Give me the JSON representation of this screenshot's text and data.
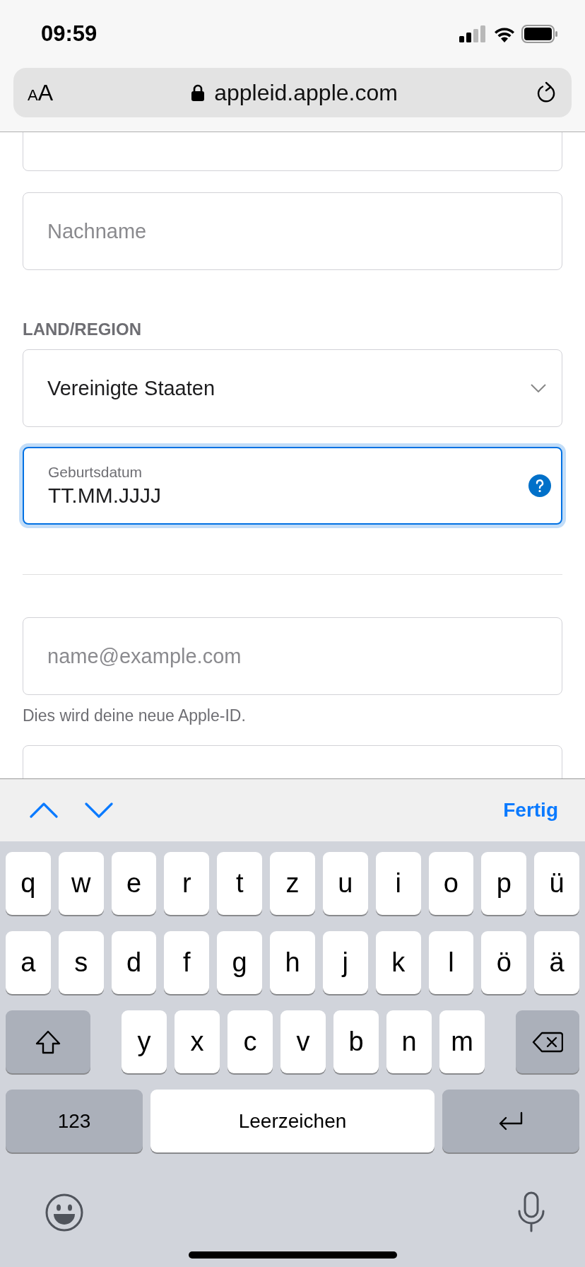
{
  "status_bar": {
    "time": "09:59"
  },
  "address_bar": {
    "text_size_label": "AA",
    "url": "appleid.apple.com"
  },
  "form": {
    "items": [
      {
        "kind": "text"
      },
      {
        "kind": "text",
        "placeholder": "Nachname"
      },
      {
        "kind": "section",
        "label": "LAND/REGION"
      },
      {
        "kind": "select",
        "value": "Vereinigte Staaten"
      },
      {
        "kind": "date",
        "label": "Geburtsdatum",
        "value": "TT.MM.JJJJ",
        "focused": true
      },
      {
        "kind": "divider"
      },
      {
        "kind": "text",
        "placeholder": "name@example.com"
      },
      {
        "kind": "hint",
        "text": "Dies wird deine neue Apple-ID."
      },
      {
        "kind": "password"
      }
    ]
  },
  "keyboard_toolbar": {
    "done": "Fertig"
  },
  "keyboard": {
    "rows": [
      {
        "keys": [
          {
            "kind": "letter",
            "label": "q"
          },
          {
            "kind": "letter",
            "label": "w"
          },
          {
            "kind": "letter",
            "label": "e"
          },
          {
            "kind": "letter",
            "label": "r"
          },
          {
            "kind": "letter",
            "label": "t"
          },
          {
            "kind": "letter",
            "label": "z"
          },
          {
            "kind": "letter",
            "label": "u"
          },
          {
            "kind": "letter",
            "label": "i"
          },
          {
            "kind": "letter",
            "label": "o"
          },
          {
            "kind": "letter",
            "label": "p"
          },
          {
            "kind": "letter",
            "label": "ü"
          }
        ]
      },
      {
        "keys": [
          {
            "kind": "letter",
            "label": "a"
          },
          {
            "kind": "letter",
            "label": "s"
          },
          {
            "kind": "letter",
            "label": "d"
          },
          {
            "kind": "letter",
            "label": "f"
          },
          {
            "kind": "letter",
            "label": "g"
          },
          {
            "kind": "letter",
            "label": "h"
          },
          {
            "kind": "letter",
            "label": "j"
          },
          {
            "kind": "letter",
            "label": "k"
          },
          {
            "kind": "letter",
            "label": "l"
          },
          {
            "kind": "letter",
            "label": "ö"
          },
          {
            "kind": "letter",
            "label": "ä"
          }
        ]
      },
      {
        "keys": [
          {
            "kind": "shift"
          },
          {
            "kind": "letter",
            "label": "y"
          },
          {
            "kind": "letter",
            "label": "x"
          },
          {
            "kind": "letter",
            "label": "c"
          },
          {
            "kind": "letter",
            "label": "v"
          },
          {
            "kind": "letter",
            "label": "b"
          },
          {
            "kind": "letter",
            "label": "n"
          },
          {
            "kind": "letter",
            "label": "m"
          },
          {
            "kind": "delete"
          }
        ]
      },
      {
        "keys": [
          {
            "kind": "numbers",
            "label": "123"
          },
          {
            "kind": "space",
            "label": "Leerzeichen"
          },
          {
            "kind": "return"
          }
        ]
      }
    ]
  }
}
